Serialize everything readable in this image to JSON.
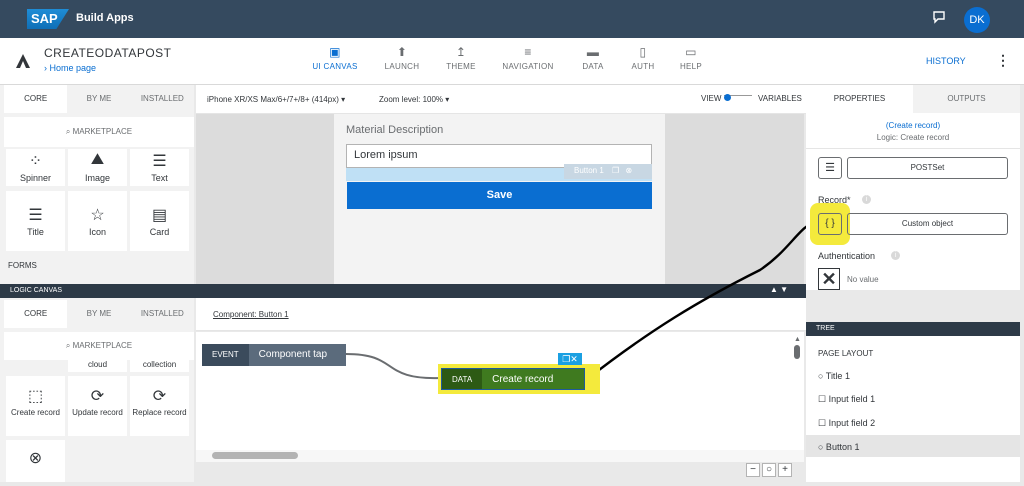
{
  "shell": {
    "logo": "SAP",
    "title": "Build  Apps",
    "avatar": "DK",
    "notification_icon": "chat-icon"
  },
  "header": {
    "project_name": "CREATEODATAPOST",
    "breadcrumb": "› Home page",
    "history": "HISTORY",
    "nav": [
      {
        "label": "UI CANVAS",
        "icon": "canvas-icon",
        "active": true
      },
      {
        "label": "LAUNCH",
        "icon": "rocket-icon"
      },
      {
        "label": "THEME",
        "icon": "brush-icon"
      },
      {
        "label": "NAVIGATION",
        "icon": "list-icon"
      },
      {
        "label": "DATA",
        "icon": "folder-icon"
      },
      {
        "label": "AUTH",
        "icon": "file-lock-icon"
      },
      {
        "label": "HELP",
        "icon": "chat-icon"
      }
    ]
  },
  "left_panel": {
    "tabs": [
      "CORE",
      "BY ME",
      "INSTALLED"
    ],
    "marketplace": "MARKETPLACE",
    "tiles_row1": [
      "Spinner",
      "Image",
      "Text"
    ],
    "tiles_row2": [
      "Title",
      "Icon",
      "Card"
    ],
    "section_forms": "FORMS"
  },
  "canvas_toolbar": {
    "device": "iPhone XR/XS Max/6+/7+/8+ (414px) ▾",
    "zoom": "Zoom level: 100% ▾",
    "view": "VIEW",
    "variables": "VARIABLES"
  },
  "canvas": {
    "field_label": "Material Description",
    "field_value": "Lorem ipsum",
    "button_overlay": "Button 1",
    "save_button": "Save"
  },
  "logic": {
    "bar_title": "LOGIC CANVAS",
    "tabs": [
      "CORE",
      "BY ME",
      "INSTALLED"
    ],
    "marketplace": "MARKETPLACE",
    "tiles_top": [
      "cloud",
      "collection"
    ],
    "tiles": [
      "Create record",
      "Update record",
      "Replace record"
    ],
    "component_label": "Component: Button 1",
    "event_node": {
      "tag": "EVENT",
      "label": "Component tap"
    },
    "data_node": {
      "tag": "DATA",
      "label": "Create record"
    }
  },
  "right_panel": {
    "tabs": [
      "PROPERTIES",
      "OUTPUTS"
    ],
    "link": "(Create record)",
    "subtitle": "Logic: Create record",
    "postset": "POSTSet",
    "record_label": "Record*",
    "custom_object": "Custom object",
    "auth_label": "Authentication",
    "no_value": "No value",
    "tree_title": "TREE",
    "tree_items": [
      "PAGE LAYOUT",
      "○ Title 1",
      "☐ Input field 1",
      "☐ Input field 2",
      "○ Button 1"
    ]
  },
  "zoom_controls": [
    "−",
    "○",
    "+"
  ]
}
